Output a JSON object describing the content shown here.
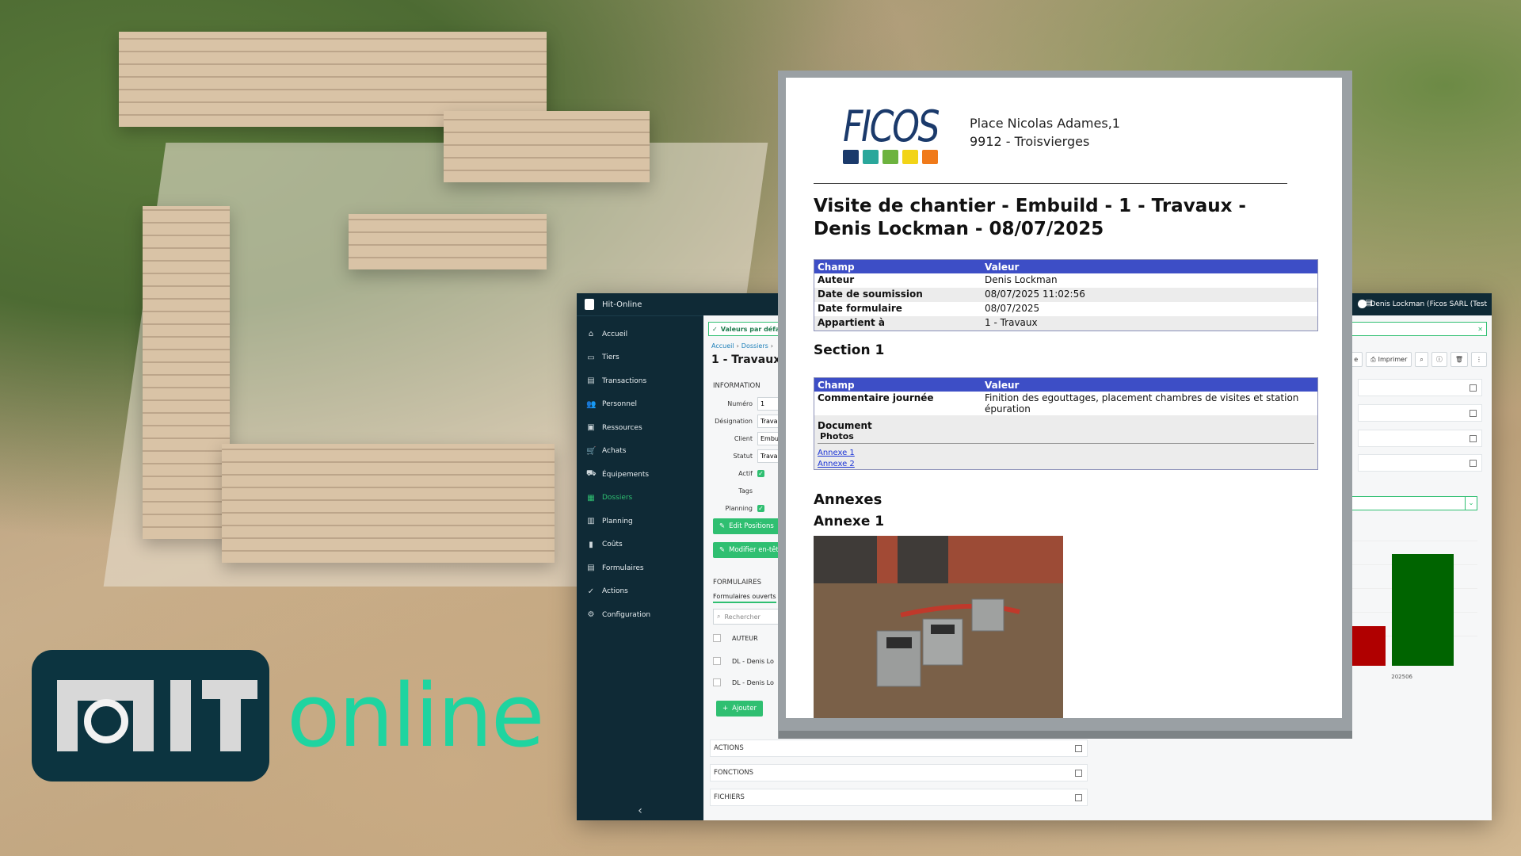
{
  "logo": {
    "wordmark": "online"
  },
  "app": {
    "brand": "Hit-Online",
    "user": "Denis Lockman (Ficos SARL (Test",
    "nav": [
      {
        "label": "Accueil",
        "icon": "home-icon"
      },
      {
        "label": "Tiers",
        "icon": "card-icon"
      },
      {
        "label": "Transactions",
        "icon": "document-icon"
      },
      {
        "label": "Personnel",
        "icon": "people-icon"
      },
      {
        "label": "Ressources",
        "icon": "box-icon"
      },
      {
        "label": "Achats",
        "icon": "cart-icon"
      },
      {
        "label": "Équipements",
        "icon": "truck-icon"
      },
      {
        "label": "Dossiers",
        "icon": "folder-icon"
      },
      {
        "label": "Planning",
        "icon": "calendar-icon"
      },
      {
        "label": "Coûts",
        "icon": "chart-icon"
      },
      {
        "label": "Formulaires",
        "icon": "form-icon"
      },
      {
        "label": "Actions",
        "icon": "check-circle-icon"
      },
      {
        "label": "Configuration",
        "icon": "gear-icon"
      }
    ],
    "notice": "Valeurs par défa",
    "breadcrumb": [
      "Accueil",
      "Dossiers"
    ],
    "page_title": "1 - Travaux",
    "toolbar": {
      "imprimer": "Imprimer",
      "partial": "e"
    },
    "information_label": "INFORMATION",
    "fields": [
      {
        "label": "Numéro",
        "value": "1"
      },
      {
        "label": "Désignation",
        "value": "Travau"
      },
      {
        "label": "Client",
        "value": "Embuil"
      },
      {
        "label": "Statut",
        "value": "Travau"
      }
    ],
    "checks": [
      {
        "label": "Actif"
      },
      {
        "label": "Tags"
      },
      {
        "label": "Planning"
      }
    ],
    "buttons": {
      "edit_positions": "Edit Positions",
      "modifier": "Modifier en-tête",
      "ajouter": "Ajouter"
    },
    "formulaires_label": "FORMULAIRES",
    "tab_open": "Formulaires ouverts",
    "search_placeholder": "Rechercher",
    "list_header": "AUTEUR",
    "list_rows": [
      "DL - Denis Lo",
      "DL - Denis Lo"
    ],
    "panels": [
      "ACTIONS",
      "FONCTIONS",
      "FICHIERS"
    ],
    "chart_x_label": "202506"
  },
  "chart_data": {
    "type": "bar",
    "categories": [
      "202506"
    ],
    "series": [
      {
        "values": [
          null
        ],
        "color": "#b00000"
      },
      {
        "values": [
          null
        ],
        "color": "#006400"
      }
    ],
    "colors": [
      "#b00000",
      "#006400"
    ],
    "relative_heights": [
      0.28,
      0.79
    ]
  },
  "report": {
    "company": "FICOS",
    "swatch_colors": [
      "#1b3a6b",
      "#2aa79b",
      "#6db33f",
      "#f2d417",
      "#f07a1a"
    ],
    "address_line1": "Place Nicolas Adames,1",
    "address_line2": "9912 - Troisvierges",
    "title": "Visite de chantier - Embuild - 1 - Travaux - Denis Lockman - 08/07/2025",
    "table_header": {
      "field": "Champ",
      "value": "Valeur"
    },
    "meta_rows": [
      {
        "k": "Auteur",
        "v": "Denis Lockman"
      },
      {
        "k": "Date de soumission",
        "v": "08/07/2025 11:02:56"
      },
      {
        "k": "Date formulaire",
        "v": "08/07/2025"
      },
      {
        "k": "Appartient à",
        "v": "1 - Travaux"
      }
    ],
    "section1": "Section 1",
    "comment_key": "Commentaire journée",
    "comment_value": "Finition des egouttages, placement chambres de visites et station épuration",
    "document_label": "Document",
    "photos_label": "Photos",
    "annex_links": [
      "Annexe 1",
      "Annexe 2"
    ],
    "annexes_heading": "Annexes",
    "annex1_heading": "Annexe 1"
  }
}
